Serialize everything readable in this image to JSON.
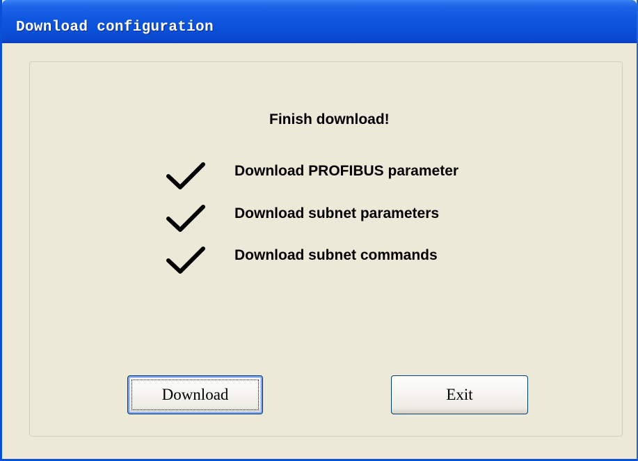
{
  "window": {
    "title": "Download configuration"
  },
  "status": {
    "heading": "Finish download!"
  },
  "steps": [
    {
      "label": "Download PROFIBUS parameter",
      "icon": "checkmark-icon",
      "done": true
    },
    {
      "label": "Download subnet parameters",
      "icon": "checkmark-icon",
      "done": true
    },
    {
      "label": "Download subnet commands",
      "icon": "checkmark-icon",
      "done": true
    }
  ],
  "buttons": {
    "download_label": "Download",
    "exit_label": "Exit"
  },
  "colors": {
    "titlebar": "#0a4fd8",
    "dialog_background": "#ece9d8",
    "button_border": "#003c74"
  }
}
